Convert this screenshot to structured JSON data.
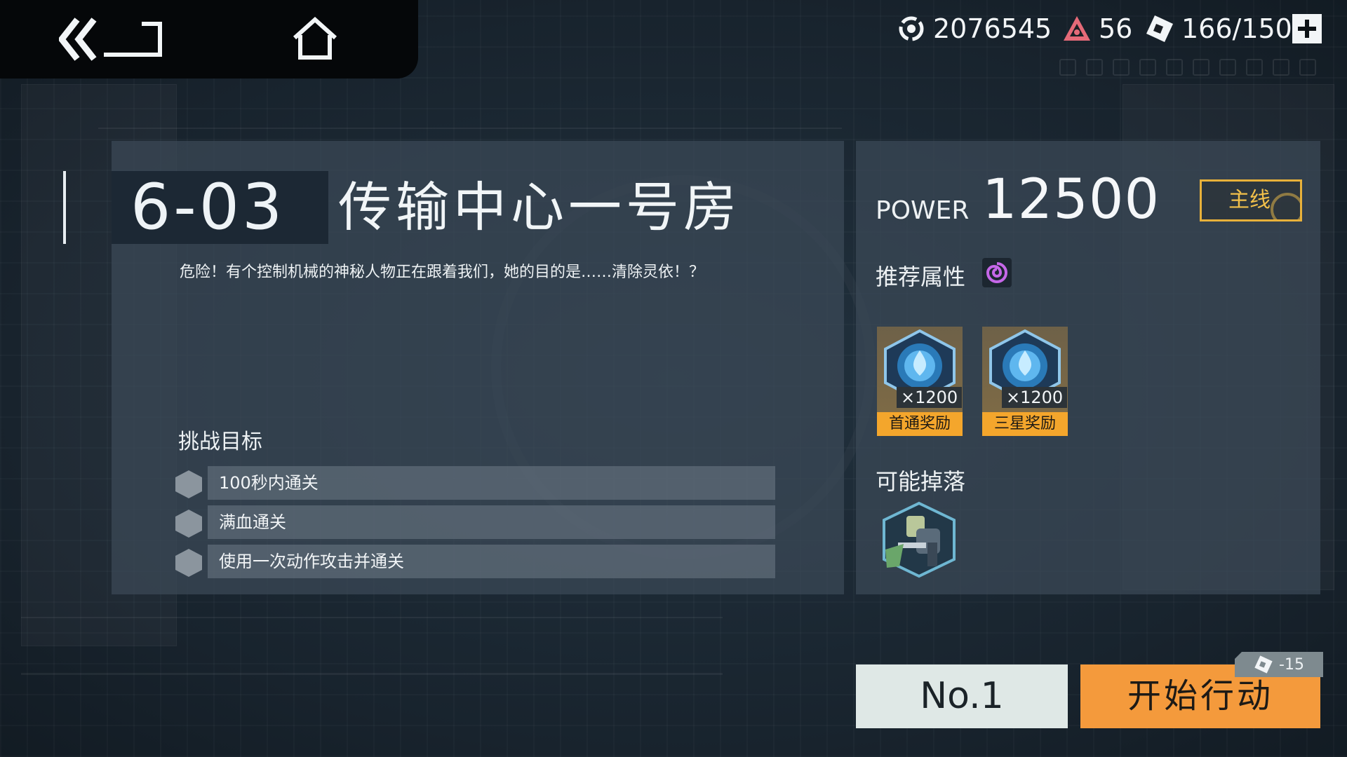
{
  "nav": {
    "back_icon": "double-chevron-back-icon",
    "home_icon": "home-icon"
  },
  "resources": {
    "coins": {
      "icon": "gear-coin-icon",
      "value": "2076545"
    },
    "crystals": {
      "icon": "warning-crystal-icon",
      "value": "56"
    },
    "stamina": {
      "icon": "ticket-stamina-icon",
      "value": "166/150"
    },
    "add_icon": "plus-icon"
  },
  "stage": {
    "code": "6-03",
    "title": "传输中心一号房",
    "description": "危险！有个控制机械的神秘人物正在跟着我们，她的目的是……清除灵依！？"
  },
  "goals": {
    "title": "挑战目标",
    "items": [
      {
        "text": "100秒内通关"
      },
      {
        "text": "满血通关"
      },
      {
        "text": "使用一次动作攻击并通关"
      }
    ]
  },
  "info": {
    "power_label": "POWER",
    "power_value": "12500",
    "tag": "主线",
    "recommended_label": "推荐属性",
    "recommended_icon": "spiral-attribute-icon",
    "rewards": [
      {
        "count": "×1200",
        "tag": "首通奖励",
        "icon": "blue-crystal-icon"
      },
      {
        "count": "×1200",
        "tag": "三星奖励",
        "icon": "blue-crystal-icon"
      }
    ],
    "drops_label": "可能掉落",
    "drops": [
      {
        "icon": "mech-robot-icon"
      }
    ]
  },
  "actions": {
    "rank_label": "No.1",
    "start_label": "开始行动",
    "cost": "-15",
    "cost_icon": "ticket-stamina-icon"
  },
  "colors": {
    "accent_orange": "#f49a3c",
    "tag_gold": "#f2c04a",
    "reward_tag": "#f4a62c"
  }
}
